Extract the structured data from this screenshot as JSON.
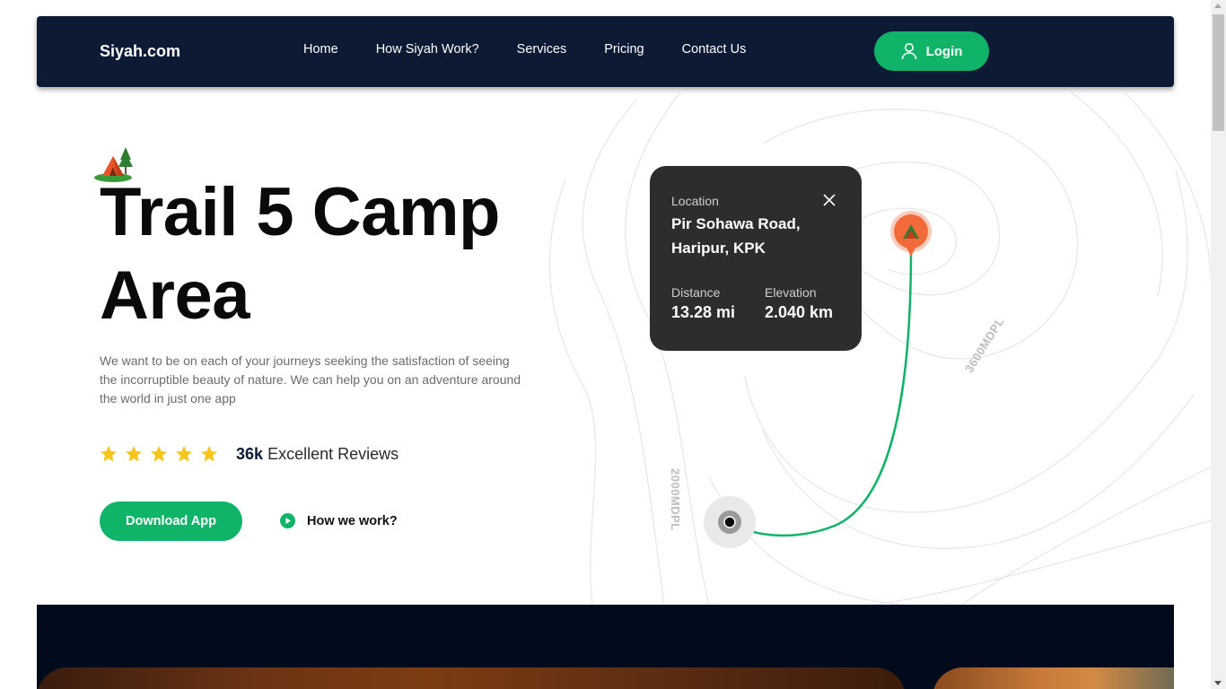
{
  "nav": {
    "brand": "Siyah.com",
    "links": [
      "Home",
      "How Siyah Work?",
      "Services",
      "Pricing",
      "Contact Us"
    ],
    "login_label": "Login",
    "user_icon": "user-icon"
  },
  "hero": {
    "emoji_icon": "camping-tent-icon",
    "title": "Trail 5 Camp Area",
    "description": "We want to be on each of your journeys seeking the satisfaction of seeing the incorruptible beauty of nature. We can help you on an adventure around the world in just one app",
    "rating_stars": 5,
    "reviews_count": "36k",
    "reviews_label": "Excellent Reviews",
    "download_label": "Download App",
    "how_label": "How we work?"
  },
  "location_card": {
    "location_label": "Location",
    "location_value": "Pir Sohawa Road, Haripur, KPK",
    "distance_label": "Distance",
    "distance_value": "13.28 mi",
    "elevation_label": "Elevation",
    "elevation_value": "2.040 km"
  },
  "map": {
    "label_high": "3600MDPL",
    "label_low": "2000MDPL"
  },
  "colors": {
    "accent": "#0fb468",
    "nav_bg": "#0c1a33",
    "card_bg": "#2b2e2b",
    "star": "#f5c518",
    "pin": "#f26a3a"
  }
}
